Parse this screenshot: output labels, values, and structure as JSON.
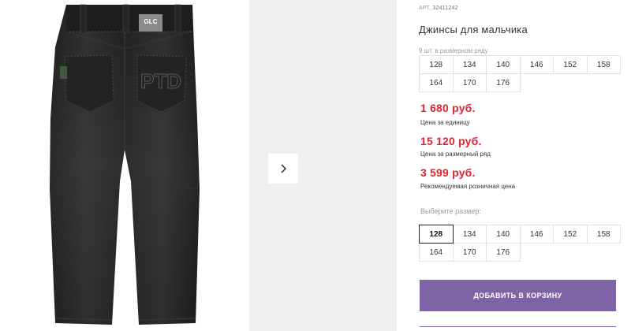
{
  "product": {
    "article_label": "АРТ.",
    "article_number": "32411242",
    "title": "Джинсы для мальчика",
    "image_label": "jeans-back-view",
    "pocket_patch_text": "PTD",
    "tag_text": "GLC"
  },
  "gallery": {
    "next_icon": "chevron-right-icon"
  },
  "pack": {
    "note": "9 шт. в размерном ряду",
    "sizes": [
      "128",
      "134",
      "140",
      "146",
      "152",
      "158",
      "164",
      "170",
      "176"
    ]
  },
  "prices": [
    {
      "amount": "1 680 руб.",
      "label": "Цена за единицу"
    },
    {
      "amount": "15 120 руб.",
      "label": "Цена за размерный ряд"
    },
    {
      "amount": "3 599 руб.",
      "label": "Рекомендуемая розничная цена"
    }
  ],
  "size_select": {
    "label": "Выберите размер:",
    "selected": "128",
    "sizes": [
      "128",
      "134",
      "140",
      "146",
      "152",
      "158",
      "164",
      "170",
      "176"
    ]
  },
  "cart": {
    "add_label": "Добавить в корзину"
  },
  "colors": {
    "accent": "#7e63a6",
    "price": "#e0242f",
    "gallery_bg": "#efefef"
  }
}
